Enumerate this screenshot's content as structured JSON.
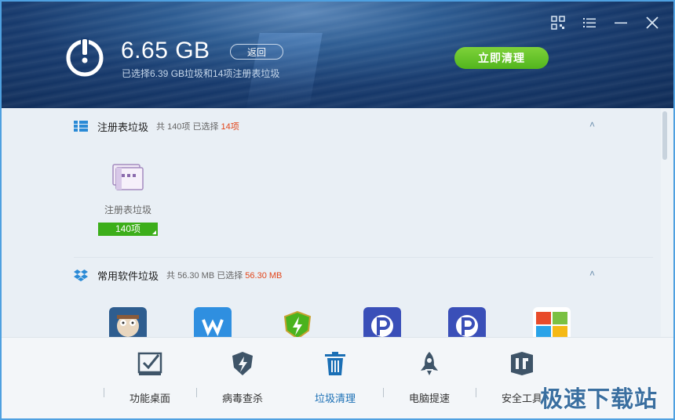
{
  "header": {
    "size": "6.65 GB",
    "back_label": "返回",
    "subtitle": "已选择6.39 GB垃圾和14项注册表垃圾",
    "clean_label": "立即清理",
    "icons": [
      "qrcode-icon",
      "menu-icon",
      "minimize-icon",
      "close-icon"
    ]
  },
  "sections": [
    {
      "title": "注册表垃圾",
      "meta_prefix": "共 140项 已选择",
      "meta_selected": "14项",
      "items": [
        {
          "label": "注册表垃圾",
          "badge": "140项"
        }
      ]
    },
    {
      "title": "常用软件垃圾",
      "meta_prefix": "共 56.30 MB 已选择",
      "meta_selected": "56.30 MB",
      "apps": [
        "app-icon-1",
        "wps-icon",
        "shield-icon",
        "p-icon",
        "p-icon",
        "office-icon"
      ]
    }
  ],
  "dock": {
    "items": [
      {
        "label": "功能桌面",
        "icon": "desktop-check-icon"
      },
      {
        "label": "病毒查杀",
        "icon": "shield-bolt-icon"
      },
      {
        "label": "垃圾清理",
        "icon": "trash-icon"
      },
      {
        "label": "电脑提速",
        "icon": "rocket-icon"
      },
      {
        "label": "安全工具",
        "icon": "toolbox-icon"
      }
    ]
  },
  "watermark": "极速下载站",
  "colors": {
    "accent_green": "#52b51d",
    "highlight_red": "#e2461b",
    "active_blue": "#1a6fb5"
  }
}
